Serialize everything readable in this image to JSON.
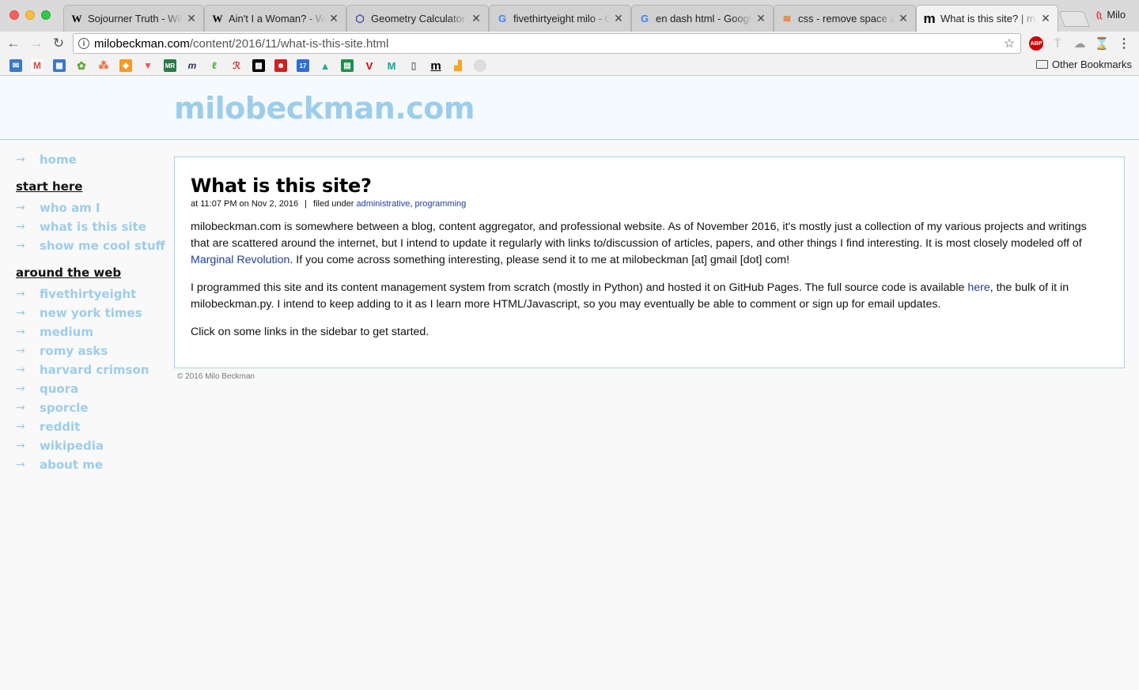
{
  "browser": {
    "tabs": [
      {
        "favicon": "W",
        "title": "Sojourner Truth - Wik"
      },
      {
        "favicon": "W",
        "title": "Ain't I a Woman? - Wi"
      },
      {
        "favicon": "⬡",
        "title": "Geometry Calculator"
      },
      {
        "favicon": "G",
        "title": "fivethirtyeight milo - G"
      },
      {
        "favicon": "G",
        "title": "en dash html - Google"
      },
      {
        "favicon": "≋",
        "title": "css - remove space ar"
      },
      {
        "favicon": "m",
        "title": "What is this site? | mil"
      }
    ],
    "profile_name": "Milo",
    "url_host": "milobeckman.com",
    "url_path": "/content/2016/11/what-is-this-site.html",
    "other_bookmarks": "Other Bookmarks",
    "colors": {
      "tab_active": "#f2f2f2",
      "tab_inactive": "#d1d1d1"
    }
  },
  "site": {
    "title": "milobeckman.com",
    "colors": {
      "accent": "#9dcdeb",
      "link": "#1f3f99",
      "border": "#a9d2e6"
    }
  },
  "sidebar": {
    "home": "home",
    "start_heading": "start here",
    "start_links": [
      "who am I",
      "what is this site",
      "show me cool stuff"
    ],
    "web_heading": "around the web",
    "web_links": [
      "fivethirtyeight",
      "new york times",
      "medium",
      "romy asks",
      "harvard crimson",
      "quora",
      "sporcle",
      "reddit",
      "wikipedia",
      "about me"
    ],
    "arrow": "→"
  },
  "post": {
    "title": "What is this site?",
    "meta_date": "at 11:07 PM on Nov 2, 2016",
    "meta_sep": "|",
    "meta_filed": "filed under",
    "tags": [
      "administrative",
      "programming"
    ],
    "p1_before": "milobeckman.com is somewhere between a blog, content aggregator, and professional website. As of November 2016, it's mostly just a collection of my various projects and writings that are scattered around the internet, but I intend to update it regularly with links to/discussion of articles, papers, and other things I find interesting. It is most closely modeled off of ",
    "p1_link": "Marginal Revolution",
    "p1_after": ". If you come across something interesting, please send it to me at milobeckman [at] gmail [dot] com!",
    "p2_before": "I programmed this site and its content management system from scratch (mostly in Python) and hosted it on GitHub Pages. The full source code is available ",
    "p2_link": "here",
    "p2_after": ", the bulk of it in milobeckman.py. I intend to keep adding to it as I learn more HTML/Javascript, so you may eventually be able to comment or sign up for email updates.",
    "p3": "Click on some links in the sidebar to get started."
  },
  "footer": "© 2016 Milo Beckman"
}
